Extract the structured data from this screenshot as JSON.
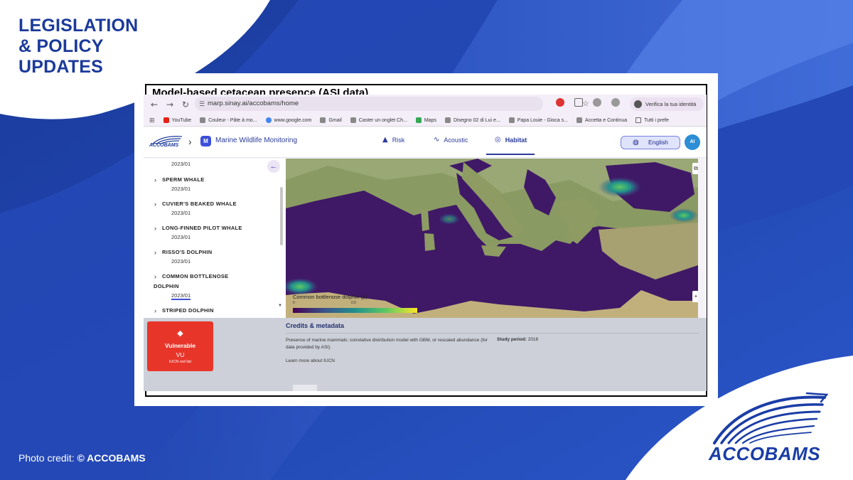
{
  "post": {
    "headline_lines": [
      "LEGISLATION",
      "& POLICY",
      "UPDATES"
    ],
    "photo_credit_prefix": "Photo credit: ",
    "photo_credit_owner": "© ACCOBAMS",
    "footer_logo_text": "ACCOBAMS",
    "card_title": "Model-based cetacean presence (ASI data)",
    "colors": {
      "brand_blue": "#1b3a9a",
      "background_blue": "#1e3fa8",
      "accent_blue": "#3c63d6"
    }
  },
  "browser": {
    "url": "marp.sinay.ai/accobams/home",
    "verify_label": "Verifica la tua identità",
    "bookmarks": [
      {
        "label": "YouTube",
        "icon": "youtube-icon"
      },
      {
        "label": "Couleur - Pâte à mo...",
        "icon": "globe-icon"
      },
      {
        "label": "www.google.com",
        "icon": "google-icon"
      },
      {
        "label": "Gmail",
        "icon": "globe-icon"
      },
      {
        "label": "Caster un onglet Ch...",
        "icon": "globe-icon"
      },
      {
        "label": "Maps",
        "icon": "maps-icon"
      },
      {
        "label": "Disegno 02 di Lui e...",
        "icon": "globe-icon"
      },
      {
        "label": "Papa Louie - Gioca s...",
        "icon": "globe-icon"
      },
      {
        "label": "Accetta e Continua",
        "icon": "globe-icon"
      },
      {
        "label": "Tutti i prefe",
        "icon": "folder-icon"
      }
    ]
  },
  "app": {
    "logo_text": "ACCOBAMS",
    "badge_letter": "M",
    "title": "Marine Wildlife Monitoring",
    "tabs": [
      {
        "label": "Risk",
        "icon": "warning-icon"
      },
      {
        "label": "Acoustic",
        "icon": "sound-wave-icon"
      },
      {
        "label": "Habitat",
        "icon": "target-icon",
        "active": true
      }
    ],
    "language": "English",
    "user_initials": "AI"
  },
  "species_panel": {
    "top_date": "2023/01",
    "items": [
      {
        "name": "SPERM WHALE",
        "date": "2023/01"
      },
      {
        "name": "CUVIER'S BEAKED WHALE",
        "date": "2023/01"
      },
      {
        "name": "LONG-FINNED PILOT WHALE",
        "date": "2023/01"
      },
      {
        "name": "RISSO'S DOLPHIN",
        "date": "2023/01"
      },
      {
        "name_line1": "COMMON BOTTLENOSE",
        "name_line2": "DOLPHIN",
        "date": "2023/01",
        "selected": true
      },
      {
        "name": "STRIPED DOLPHIN"
      }
    ]
  },
  "map": {
    "legend_label": "Common bottlenose dolphin (p)",
    "legend_ticks": [
      "0",
      "0.5",
      "1"
    ],
    "colormap": [
      "#440154",
      "#3b528b",
      "#21918c",
      "#5ec962",
      "#fde725"
    ]
  },
  "details": {
    "status": "Vulnerable",
    "status_code": "VU",
    "status_source": "IUCN red list",
    "credits_title": "Credits & metadata",
    "description": "Presence of marine mammals: correlative distribution model with GBM, or rescaled abundance (for data provided by ASI).",
    "study_period_label": "Study period:",
    "study_period_value": "2018",
    "learn_more": "Learn more about IUCN"
  }
}
